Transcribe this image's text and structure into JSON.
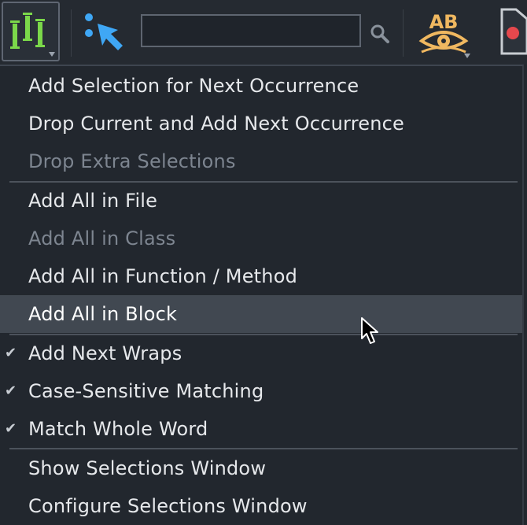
{
  "toolbar": {
    "multi_selection_icon": "multi-cursor-icon",
    "select_tool_icon": "select-pointer-icon",
    "search": {
      "value": "",
      "placeholder": ""
    },
    "search_icon": "magnifier-icon",
    "spell_icon": "spell-check-icon",
    "spell_icon_text": "AB",
    "record_icon": "record-icon",
    "colors": {
      "multi_icon": "#7bd84a",
      "pointer": "#3fa7f5",
      "spell_letters": "#f0b860",
      "record": "#e5484d"
    }
  },
  "menu": {
    "groups": [
      {
        "items": [
          {
            "label": "Add Selection for Next Occurrence",
            "enabled": true
          },
          {
            "label": "Drop Current and Add Next Occurrence",
            "enabled": true
          },
          {
            "label": "Drop Extra Selections",
            "enabled": false
          }
        ]
      },
      {
        "items": [
          {
            "label": "Add All in File",
            "enabled": true
          },
          {
            "label": "Add All in Class",
            "enabled": false
          },
          {
            "label": "Add All in Function / Method",
            "enabled": true
          },
          {
            "label": "Add All in Block",
            "enabled": true,
            "highlighted": true
          }
        ]
      },
      {
        "items": [
          {
            "label": "Add Next Wraps",
            "enabled": true,
            "checked": true
          },
          {
            "label": "Case-Sensitive Matching",
            "enabled": true,
            "checked": true
          },
          {
            "label": "Match Whole Word",
            "enabled": true,
            "checked": true
          }
        ]
      },
      {
        "items": [
          {
            "label": "Show Selections Window",
            "enabled": true
          },
          {
            "label": "Configure Selections Window",
            "enabled": true
          }
        ]
      }
    ],
    "check_glyph": "✔",
    "highlight_color": "#414851"
  }
}
